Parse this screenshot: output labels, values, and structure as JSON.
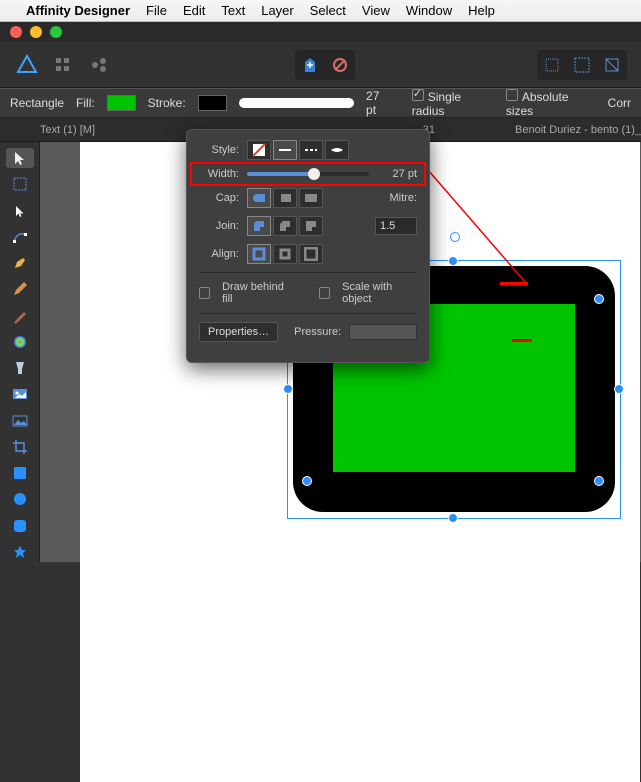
{
  "menubar": {
    "apple": "",
    "app": "Affinity Designer",
    "items": [
      "File",
      "Edit",
      "Text",
      "Layer",
      "Select",
      "View",
      "Window",
      "Help"
    ]
  },
  "context": {
    "shape": "Rectangle",
    "fill_label": "Fill:",
    "fill_color": "#00c400",
    "stroke_label": "Stroke:",
    "stroke_color": "#000000",
    "stroke_width": "27 pt",
    "single_radius": "Single radius",
    "absolute_sizes": "Absolute sizes",
    "corr": "Corr"
  },
  "tabs": {
    "tab1": "Text (1) [M]",
    "tab2_suffix": "31",
    "tab3": "Benoit Duriez - bento (1)_"
  },
  "popover": {
    "style_label": "Style:",
    "width_label": "Width:",
    "width_value": "27 pt",
    "cap_label": "Cap:",
    "join_label": "Join:",
    "align_label": "Align:",
    "mitre_label": "Mitre:",
    "mitre_value": "1.5",
    "draw_behind": "Draw behind fill",
    "scale_with": "Scale with object",
    "properties": "Properties…",
    "pressure_label": "Pressure:"
  },
  "tools": [
    "move",
    "marquee",
    "node",
    "corner",
    "pen",
    "pencil",
    "brush",
    "color",
    "glass",
    "sprite",
    "image",
    "crop",
    "rect",
    "circle",
    "roundsq",
    "star"
  ]
}
